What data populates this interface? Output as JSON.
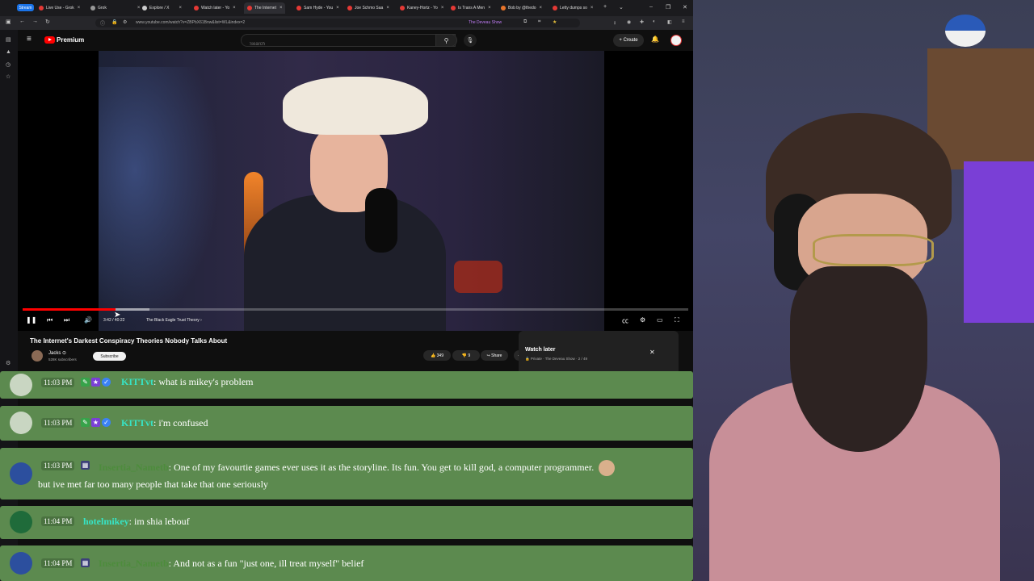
{
  "browser": {
    "stream_badge": "Stream",
    "tabs": [
      {
        "label": "Live Use - Grok"
      },
      {
        "label": "Grok"
      },
      {
        "label": "Explore / X"
      },
      {
        "label": "Watch later - Yo"
      },
      {
        "label": "The Internet"
      },
      {
        "label": "Sam Hyde - You"
      },
      {
        "label": "Joe Schmo Saa"
      },
      {
        "label": "Kaney-Hortz - Yo"
      },
      {
        "label": "Is Trans A Men"
      },
      {
        "label": "Bob by @thedo"
      },
      {
        "label": "Letty dumps so"
      }
    ],
    "new_tab": "+",
    "url": "www.youtube.com/watch?v=ZBPbX61Bnw&list=WL&index=2",
    "bookmark_label": "The Deveau Show"
  },
  "youtube": {
    "brand": "Premium",
    "search_placeholder": "Search",
    "create_label": "+ Create",
    "video": {
      "progress_fraction": 0.14,
      "buffer_fraction": 0.19,
      "time": "3:42 / 40:22",
      "chapter": "The Black Eagle Trust Theory ›",
      "title": "The Internet's Darkest Conspiracy Theories Nobody Talks About"
    },
    "channel": {
      "name": "Jacks ⊙",
      "subs": "528K subscribers",
      "subscribe_label": "Subscribe"
    },
    "actions": {
      "likes": "349",
      "dislikes": "9",
      "share": "Share",
      "more": "⋯"
    },
    "watch_later": {
      "title": "Watch later",
      "subtitle": "🔒 Private · The Deveau Show · 2 / 49"
    }
  },
  "chat": {
    "messages": [
      {
        "time": "11:03 PM",
        "user": "KITTvt",
        "text": ": what is mikey's problem"
      },
      {
        "time": "11:03 PM",
        "user": "KITTvt",
        "text": ": i'm confused"
      },
      {
        "time": "11:03 PM",
        "user": "Insertia_Nametb",
        "text": ": One of my favourtie games ever uses it as the storyline. Its fun. You get to kill god, a computer programmer.",
        "text2": "but ive met far too many people that take that one seriously"
      },
      {
        "time": "11:04 PM",
        "user": "hotelmikey",
        "text": ": im shia lebouf"
      },
      {
        "time": "11:04 PM",
        "user": "Insertia_Nametb",
        "text": ": And not as a fun \"just one, ill treat myself\" belief"
      }
    ]
  }
}
